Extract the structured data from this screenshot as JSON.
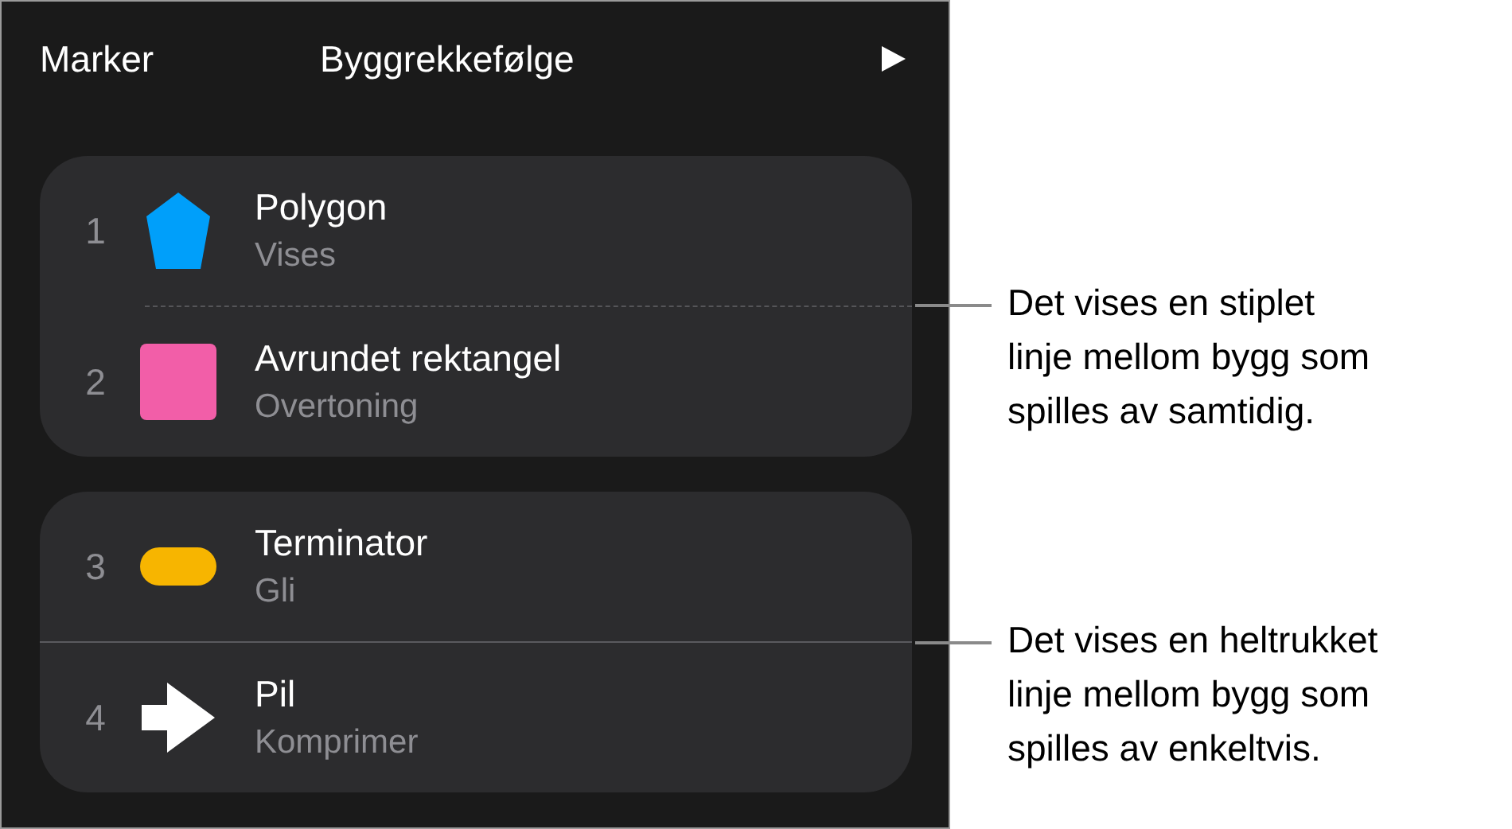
{
  "header": {
    "select_button": "Marker",
    "title": "Byggrekkefølge"
  },
  "groups": [
    {
      "separator": {
        "kind": "dashed"
      },
      "builds": [
        {
          "number": "1",
          "name": "Polygon",
          "effect": "Vises",
          "kind": "pentagon",
          "color": "#009ffa"
        },
        {
          "number": "2",
          "name": "Avrundet rektangel",
          "effect": "Overtoning",
          "kind": "square",
          "color": "#f25ea8"
        }
      ]
    },
    {
      "separator": {
        "kind": "solid"
      },
      "builds": [
        {
          "number": "3",
          "name": "Terminator",
          "effect": "Gli",
          "kind": "pill",
          "color": "#f7b500"
        },
        {
          "number": "4",
          "name": "Pil",
          "effect": "Komprimer",
          "kind": "arrow",
          "color": "#ffffff"
        }
      ]
    }
  ],
  "callouts": [
    {
      "lines": [
        "Det vises en stiplet",
        "linje mellom bygg som",
        "spilles av samtidig."
      ]
    },
    {
      "lines": [
        "Det vises en heltrukket",
        "linje mellom bygg som",
        "spilles av enkeltvis."
      ]
    }
  ]
}
